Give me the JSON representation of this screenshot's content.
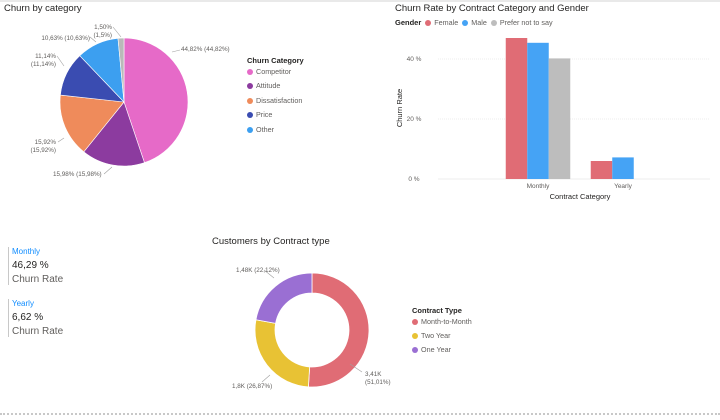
{
  "pie_chart": {
    "title": "Churn by category",
    "legend_title": "Churn Category",
    "chart_data": {
      "type": "pie",
      "categories": [
        "Competitor",
        "Attitude",
        "Dissatisfaction",
        "Price",
        "Other"
      ],
      "values": [
        44.82,
        15.98,
        15.92,
        11.14,
        10.63
      ],
      "labels": [
        "44,82% (44,82%)",
        "15,98% (15,98%)",
        "15,92% (15,92%)",
        "11,14% (11,14%)",
        "10,63% (10,63%)"
      ],
      "extra_slice": {
        "value": 1.5,
        "label_top": "1,50%",
        "label_bottom": "(1,5%)"
      },
      "colors": [
        "#e66ac8",
        "#8c3b9f",
        "#ef8b5b",
        "#3a4cb1",
        "#3c9ff0",
        "#b9b9b9"
      ]
    }
  },
  "bar_chart": {
    "title": "Churn Rate by Contract Category and Gender",
    "legend_title": "Gender",
    "chart_data": {
      "type": "bar",
      "categories": [
        "Monthly",
        "Yearly"
      ],
      "series": [
        {
          "name": "Female",
          "values": [
            47.0,
            6.0
          ],
          "color": "#e06c75"
        },
        {
          "name": "Male",
          "values": [
            45.4,
            7.2
          ],
          "color": "#45a3f5"
        },
        {
          "name": "Prefer not to say",
          "values": [
            40.2,
            null
          ],
          "color": "#bdbdbd"
        }
      ],
      "xlabel": "Contract Category",
      "ylabel": "Churn Rate",
      "ylim": [
        0,
        50
      ],
      "yticks": [
        0,
        20,
        40
      ],
      "ytick_labels": [
        "0 %",
        "20 %",
        "40 %"
      ]
    }
  },
  "cards": [
    {
      "category": "Monthly",
      "value": "46,29 %",
      "label": "Churn Rate"
    },
    {
      "category": "Yearly",
      "value": "6,62 %",
      "label": "Churn Rate"
    }
  ],
  "donut_chart": {
    "title": "Customers by Contract type",
    "legend_title": "Contract Type",
    "chart_data": {
      "type": "pie",
      "categories": [
        "Month-to-Month",
        "Two Year",
        "One Year"
      ],
      "values": [
        51.01,
        26.87,
        22.12
      ],
      "labels": [
        "3,41K (51,01%)",
        "1,8K (26,87%)",
        "1,48K (22,12%)"
      ],
      "colors": [
        "#e06c75",
        "#e8c234",
        "#9a6fd3"
      ]
    }
  }
}
